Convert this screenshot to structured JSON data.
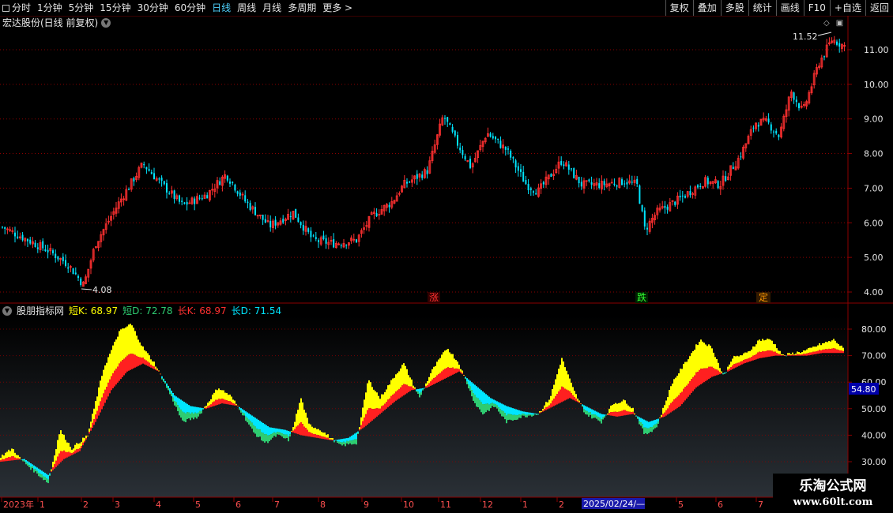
{
  "toolbar": {
    "tabs": [
      "分时",
      "1分钟",
      "5分钟",
      "15分钟",
      "30分钟",
      "60分钟",
      "日线",
      "周线",
      "月线",
      "多周期",
      "更多 >"
    ],
    "active_tab": "日线",
    "tools": [
      "复权",
      "叠加",
      "多股",
      "统计",
      "画线",
      "F10",
      "+自选",
      "返回"
    ]
  },
  "stock": {
    "title": "宏达股份(日线 前复权)",
    "high_label": "11.52",
    "low_label": "4.08",
    "price_axis": [
      "11.00",
      "10.00",
      "9.00",
      "8.00",
      "7.00",
      "6.00",
      "5.00",
      "4.00"
    ],
    "markers": [
      {
        "text": "涨",
        "color": "#ff3030"
      },
      {
        "text": "跌",
        "color": "#30ff30"
      },
      {
        "text": "定",
        "color": "#ff9900"
      }
    ]
  },
  "indicator": {
    "name": "股朋指标网",
    "values": [
      {
        "label": "短K: 68.97",
        "color": "#ffff00"
      },
      {
        "label": "短D: 72.78",
        "color": "#2ecc71"
      },
      {
        "label": "长K: 68.97",
        "color": "#ff3030"
      },
      {
        "label": "长D: 71.54",
        "color": "#00e5ff"
      }
    ],
    "axis": [
      "80.00",
      "70.00",
      "60.00",
      "50.00",
      "40.00",
      "30.00"
    ],
    "current_value": "54.80"
  },
  "time_axis": {
    "labels": [
      "2023年",
      "1",
      "2",
      "3",
      "4",
      "5",
      "6",
      "7",
      "8",
      "9",
      "10",
      "11",
      "12",
      "1",
      "2",
      "5",
      "6",
      "7"
    ],
    "cursor_date": "2025/02/24/—"
  },
  "watermark": {
    "line1": "乐淘公式网",
    "line2": "www.60lt.com"
  },
  "colors": {
    "up": "#ff3030",
    "down": "#00e5ff",
    "grid": "#8b0000",
    "yellow": "#ffff00",
    "green": "#2ecc71",
    "cyan": "#00e5ff",
    "red": "#ff2020"
  }
}
